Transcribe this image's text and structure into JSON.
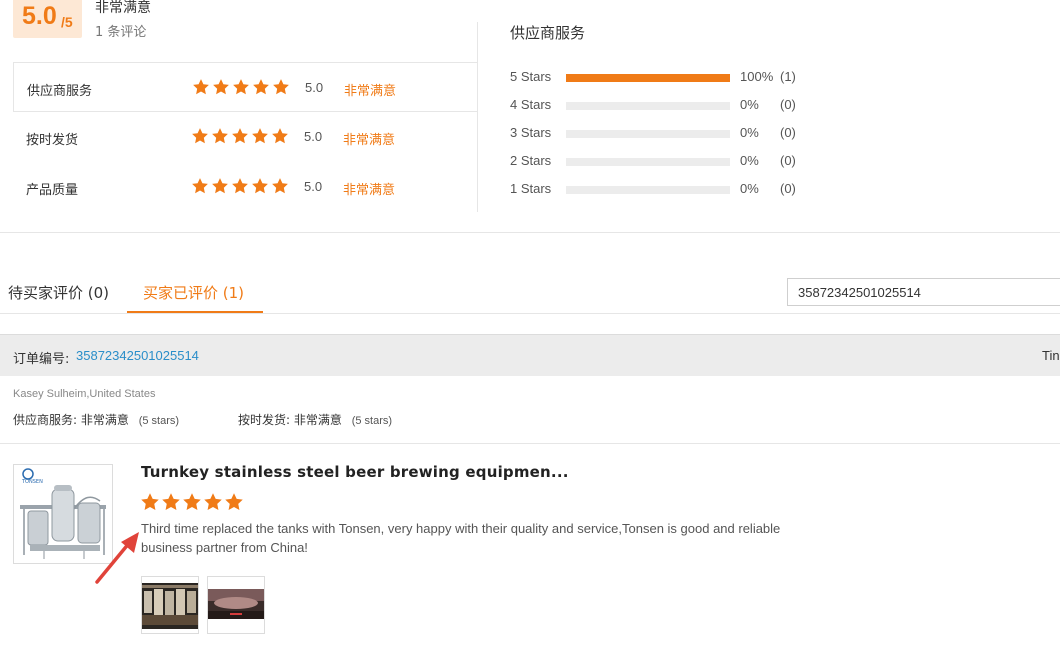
{
  "summary": {
    "score": "5.0",
    "score_max": "/5",
    "overall_label": "非常满意",
    "review_count": "1 条评论"
  },
  "ratings": [
    {
      "label": "供应商服务",
      "stars": 5,
      "value": "5.0",
      "word": "非常满意"
    },
    {
      "label": "按时发货",
      "stars": 5,
      "value": "5.0",
      "word": "非常满意"
    },
    {
      "label": "产品质量",
      "stars": 5,
      "value": "5.0",
      "word": "非常满意"
    }
  ],
  "distribution": {
    "title": "供应商服务",
    "rows": [
      {
        "label": "5  Stars",
        "percent": "100%",
        "count": "(1)",
        "fill": 1.0
      },
      {
        "label": "4  Stars",
        "percent": "0%",
        "count": "(0)",
        "fill": 0
      },
      {
        "label": "3  Stars",
        "percent": "0%",
        "count": "(0)",
        "fill": 0
      },
      {
        "label": "2  Stars",
        "percent": "0%",
        "count": "(0)",
        "fill": 0
      },
      {
        "label": "1  Stars",
        "percent": "0%",
        "count": "(0)",
        "fill": 0
      }
    ]
  },
  "tabs": {
    "pending": "待买家评价 (0)",
    "done": "买家已评价 (1)"
  },
  "search": {
    "value": "35872342501025514"
  },
  "order": {
    "label": "订单编号:",
    "number": "35872342501025514",
    "time_label": "Tin"
  },
  "review": {
    "buyer": "Kasey Sulheim,United States",
    "sub_ratings": [
      {
        "label": "供应商服务:",
        "word": "非常满意",
        "stars_text": "(5 stars)"
      },
      {
        "label": "按时发货:",
        "word": "非常满意",
        "stars_text": "(5 stars)"
      }
    ],
    "product_title": "Turnkey stainless steel beer brewing equipmen...",
    "product_logo": "TONSEN",
    "stars": 5,
    "text": "Third time replaced the tanks with Tonsen, very happy with their quality and service,Tonsen is good and reliable business partner from China!"
  },
  "colors": {
    "accent": "#f07b17",
    "link": "#2a8ec9",
    "arrow": "#e0433a"
  }
}
